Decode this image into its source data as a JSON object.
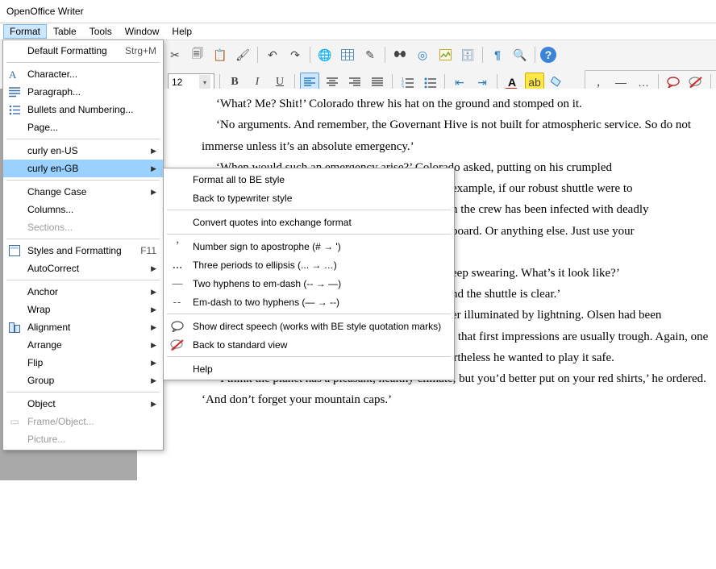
{
  "title": "OpenOffice Writer",
  "menubar": {
    "format": "Format",
    "table": "Table",
    "tools": "Tools",
    "window": "Window",
    "help": "Help"
  },
  "fontSize": "12",
  "formatMenu": {
    "defaultFormatting": "Default Formatting",
    "defaultFormattingKey": "Strg+M",
    "character": "Character...",
    "paragraph": "Paragraph...",
    "bullets": "Bullets and Numbering...",
    "page": "Page...",
    "curlyUS": "curly en-US",
    "curlyGB": "curly en-GB",
    "changeCase": "Change Case",
    "columns": "Columns...",
    "sections": "Sections...",
    "styles": "Styles and Formatting",
    "stylesKey": "F11",
    "autoCorrect": "AutoCorrect",
    "anchor": "Anchor",
    "wrap": "Wrap",
    "alignment": "Alignment",
    "arrange": "Arrange",
    "flip": "Flip",
    "group": "Group",
    "object": "Object",
    "frameObject": "Frame/Object...",
    "picture": "Picture..."
  },
  "submenu": {
    "formatAll": "Format all to BE style",
    "backType": "Back to typewriter style",
    "convertQuotes": "Convert quotes into exchange format",
    "numberSign": "Number sign to apostrophe (# → ')",
    "ellipsis": "Three periods to ellipsis (... → …)",
    "twoHyph": "Two hyphens to em-dash (-- → —)",
    "emDash": "Em-dash to two hyphens (— → --)",
    "direct": "Show direct speech (works with BE style quotation marks)",
    "standard": "Back to standard view",
    "help": "Help"
  },
  "doc": {
    "p1": "‘What? Me? Shit!’ Colorado threw his hat on the ground and stomped on it.",
    "p2": "‘No arguments. And remember, the Governant Hive is not built for atmospheric service. So do not immerse unless it’s an absolute emergency.’",
    "p3a": "‘When would such an emergency arise?’ Colorado asked, putting on his crumpled",
    "p3b_tail": "",
    "p4a_head": "",
    "p4a": "example, if our robust shuttle were to",
    "p4b_head": "",
    "p4b": "n the crew has been infected with deadly",
    "p4c_head": "",
    "p4c": "board. Or anything else. Just use your",
    "p5a": "eep swearing. What’s it look like?’",
    "p5b": "nd the shuttle is clear.’",
    "p6a": "er illuminated by lightning. Olsen had been",
    "p6b": "studying planetary exploration long enough to know that first impressions are usually trough. Again, one could expect a soft core under the rough shell. Nevertheless he wanted to play it safe.",
    "p7": "‘I think the planet has a pleasant, healthy climate, but you’d better put on your red shirts,’ he ordered. ‘And don’t forget your mountain caps.’"
  }
}
